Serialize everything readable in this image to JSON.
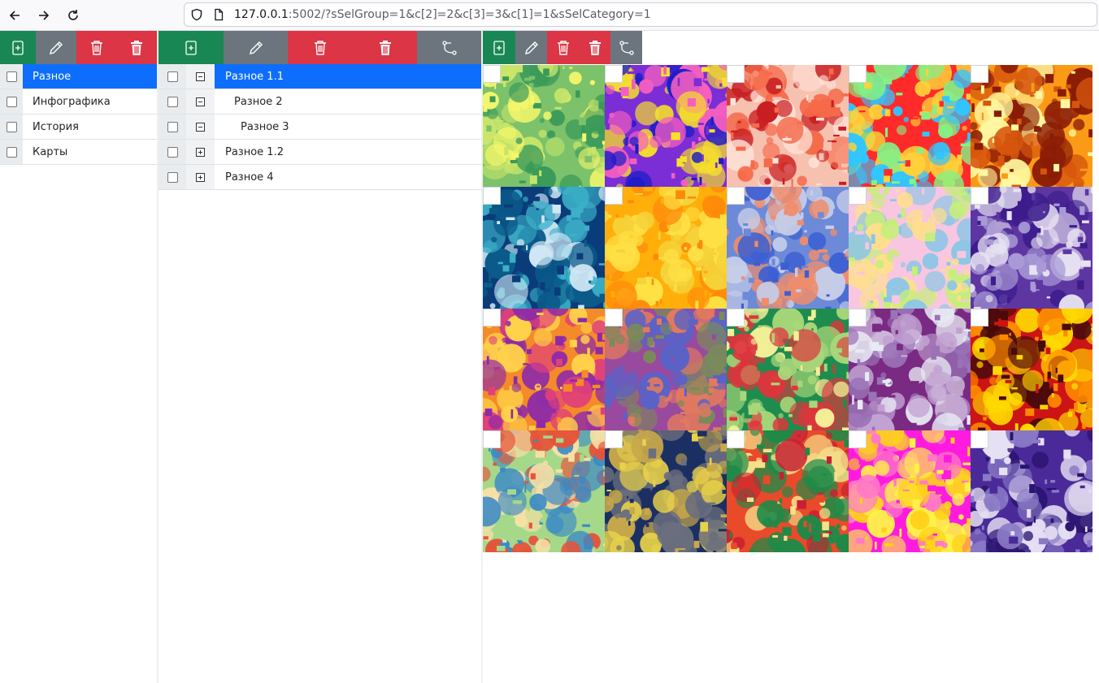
{
  "browser": {
    "url_host": "127.0.0.1",
    "url_rest": ":5002/?sSelGroup=1&c[2]=2&c[3]=3&c[1]=1&sSelCategory=1"
  },
  "categories": [
    {
      "label": "Разное",
      "selected": true
    },
    {
      "label": "Инфографика",
      "selected": false
    },
    {
      "label": "История",
      "selected": false
    },
    {
      "label": "Карты",
      "selected": false
    }
  ],
  "groups": [
    {
      "label": "Разное 1.1",
      "level": 0,
      "toggle": "minus",
      "selected": true
    },
    {
      "label": "Разное 2",
      "level": 1,
      "toggle": "minus",
      "selected": false
    },
    {
      "label": "Разное 3",
      "level": 2,
      "toggle": "minus",
      "selected": false
    },
    {
      "label": "Разное 1.2",
      "level": 0,
      "toggle": "plus",
      "selected": false
    },
    {
      "label": "Разное 4",
      "level": 0,
      "toggle": "plus",
      "selected": false
    }
  ],
  "colors": {
    "green": "#198754",
    "gray": "#6c757d",
    "red": "#dc3545",
    "selected": "#0d6efd"
  },
  "tiles": [
    {
      "colors": [
        "#7cc26b",
        "#c5e46a",
        "#3a9a5a",
        "#f4f76a"
      ]
    },
    {
      "colors": [
        "#7b2dd6",
        "#1c1cc8",
        "#f45fbf",
        "#f6e02a"
      ]
    },
    {
      "colors": [
        "#f7c1b0",
        "#c81f22",
        "#f56a4a",
        "#ffe3d8"
      ]
    },
    {
      "colors": [
        "#ff2a2a",
        "#30c6ff",
        "#86f084",
        "#ffd23a"
      ]
    },
    {
      "colors": [
        "#fb9a16",
        "#8a1c05",
        "#fff7a0",
        "#d6560d"
      ]
    },
    {
      "colors": [
        "#0a3c7a",
        "#3bb0c8",
        "#cfe7f4",
        "#0b5a8a"
      ]
    },
    {
      "colors": [
        "#ffae0a",
        "#ffe145",
        "#ff8a0a",
        "#f5d33a"
      ]
    },
    {
      "colors": [
        "#6c8ad8",
        "#f08d6b",
        "#c6cde8",
        "#3b5fd2"
      ]
    },
    {
      "colors": [
        "#f8c6e0",
        "#8cc6e6",
        "#c6ee7a",
        "#ffe08a"
      ]
    },
    {
      "colors": [
        "#5e36a2",
        "#a89ad6",
        "#e6e2f2",
        "#3d1c8c"
      ]
    },
    {
      "colors": [
        "#f48a2a",
        "#8e2aa8",
        "#ffd24a",
        "#e0407a"
      ]
    },
    {
      "colors": [
        "#9a4a9e",
        "#7a8a5a",
        "#e27a5e",
        "#5a62c6"
      ]
    },
    {
      "colors": [
        "#1e8c4e",
        "#f2f098",
        "#e0343c",
        "#a8d67a"
      ]
    },
    {
      "colors": [
        "#7a2a82",
        "#c2a2d2",
        "#e8eaf4",
        "#9a72b6"
      ]
    },
    {
      "colors": [
        "#cc1414",
        "#ff8a00",
        "#ffd800",
        "#4a0a0a"
      ]
    },
    {
      "colors": [
        "#a6d88a",
        "#e6533a",
        "#3a8ac6",
        "#f6e0a6"
      ]
    },
    {
      "colors": [
        "#1c2f62",
        "#c8a84a",
        "#6a6e7e",
        "#e8d24a"
      ]
    },
    {
      "colors": [
        "#e84a2a",
        "#f6e08a",
        "#1f8a48",
        "#c81f32"
      ]
    },
    {
      "colors": [
        "#ff1ae0",
        "#ffd21a",
        "#ff7ac6",
        "#fff04a"
      ]
    },
    {
      "colors": [
        "#4a2a98",
        "#8a7ac6",
        "#e6e0f4",
        "#2a1470"
      ]
    }
  ]
}
